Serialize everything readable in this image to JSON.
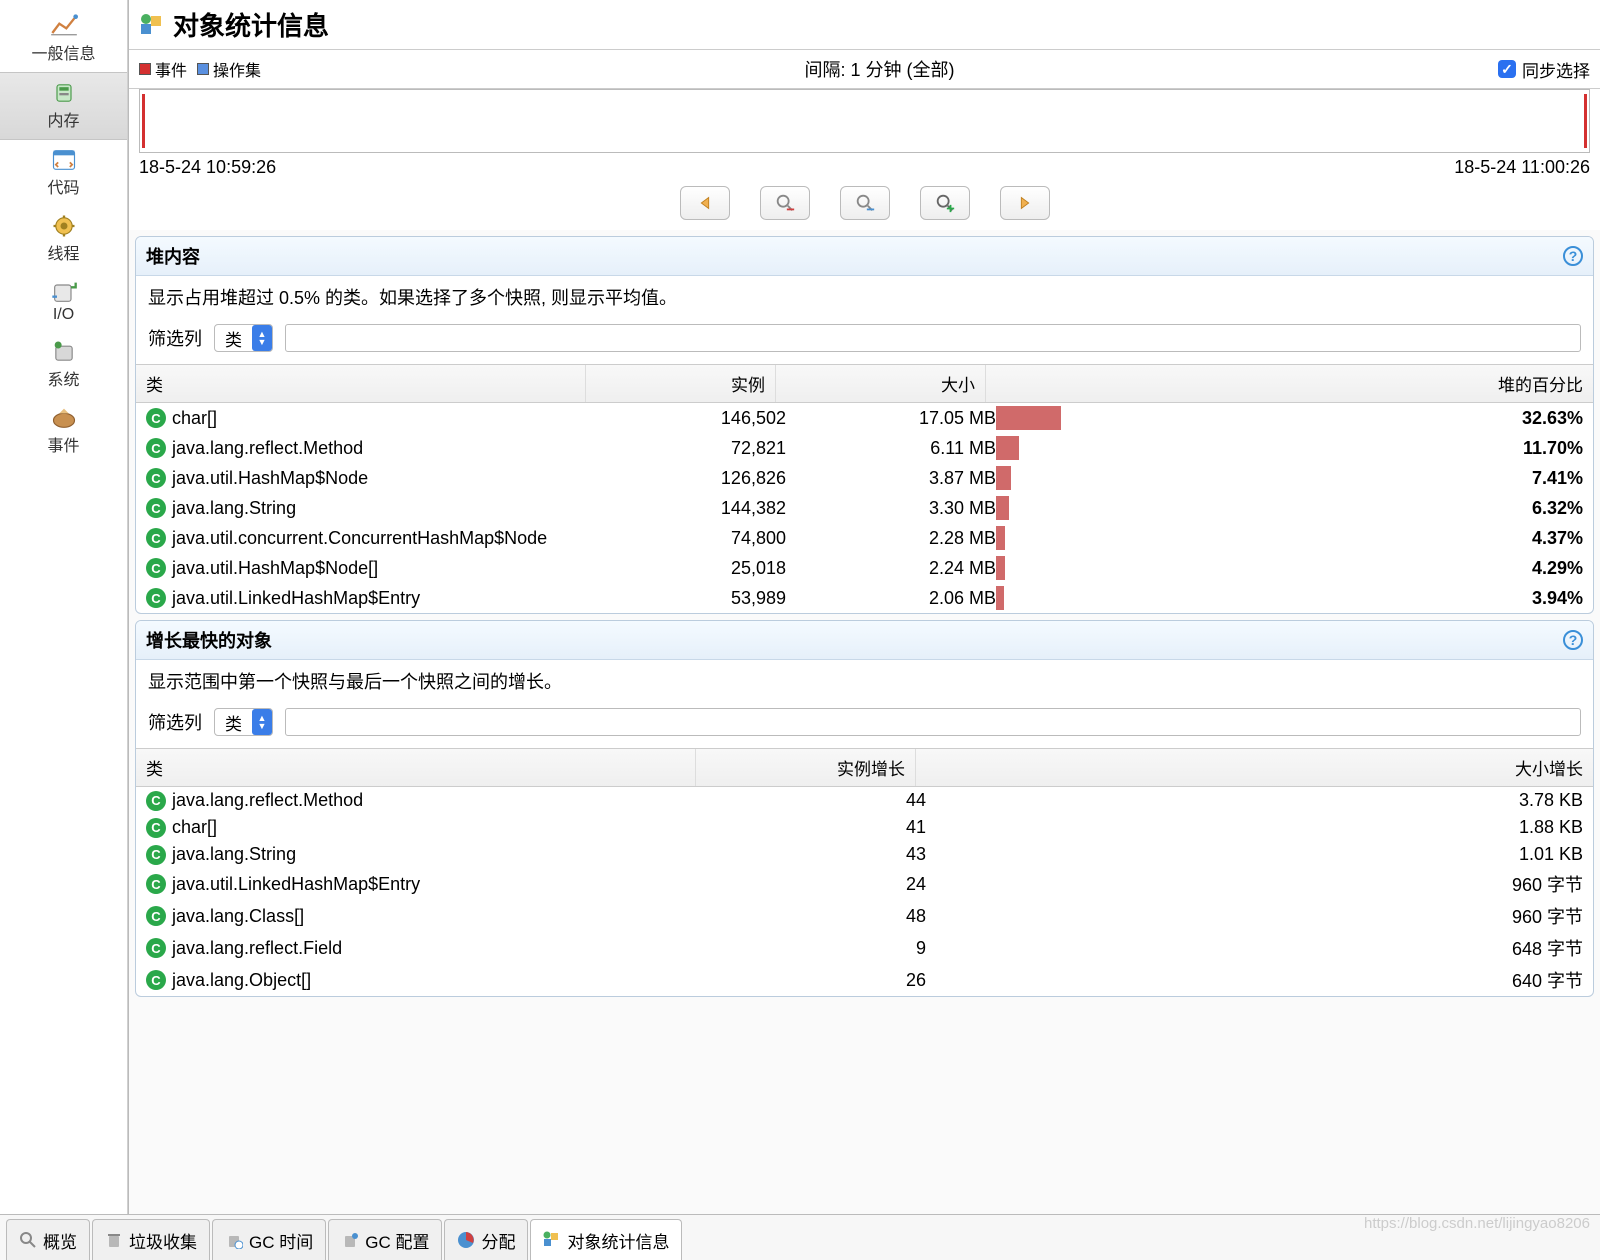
{
  "sidebar": {
    "items": [
      {
        "label": "一般信息",
        "icon": "chart-overview"
      },
      {
        "label": "内存",
        "icon": "memory",
        "active": true
      },
      {
        "label": "代码",
        "icon": "code"
      },
      {
        "label": "线程",
        "icon": "threads"
      },
      {
        "label": "I/O",
        "icon": "io"
      },
      {
        "label": "系统",
        "icon": "system"
      },
      {
        "label": "事件",
        "icon": "events"
      }
    ]
  },
  "page": {
    "title": "对象统计信息"
  },
  "interval": {
    "legend_event": "事件",
    "legend_opset": "操作集",
    "label": "间隔: 1 分钟 (全部)",
    "sync_label": "同步选择",
    "start_time": "18-5-24 10:59:26",
    "end_time": "18-5-24 11:00:26"
  },
  "heap_panel": {
    "title": "堆内容",
    "desc": "显示占用堆超过 0.5% 的类。如果选择了多个快照, 则显示平均值。",
    "filter_label": "筛选列",
    "filter_select": "类",
    "columns": [
      "类",
      "实例",
      "大小",
      "堆的百分比"
    ],
    "rows": [
      {
        "class": "char[]",
        "instances": "146,502",
        "size": "17.05 MB",
        "pct": "32.63%",
        "pct_num": 32.63
      },
      {
        "class": "java.lang.reflect.Method",
        "instances": "72,821",
        "size": "6.11 MB",
        "pct": "11.70%",
        "pct_num": 11.7
      },
      {
        "class": "java.util.HashMap$Node",
        "instances": "126,826",
        "size": "3.87 MB",
        "pct": "7.41%",
        "pct_num": 7.41
      },
      {
        "class": "java.lang.String",
        "instances": "144,382",
        "size": "3.30 MB",
        "pct": "6.32%",
        "pct_num": 6.32
      },
      {
        "class": "java.util.concurrent.ConcurrentHashMap$Node",
        "instances": "74,800",
        "size": "2.28 MB",
        "pct": "4.37%",
        "pct_num": 4.37
      },
      {
        "class": "java.util.HashMap$Node[]",
        "instances": "25,018",
        "size": "2.24 MB",
        "pct": "4.29%",
        "pct_num": 4.29
      },
      {
        "class": "java.util.LinkedHashMap$Entry",
        "instances": "53,989",
        "size": "2.06 MB",
        "pct": "3.94%",
        "pct_num": 3.94
      }
    ]
  },
  "growth_panel": {
    "title": "增长最快的对象",
    "desc": "显示范围中第一个快照与最后一个快照之间的增长。",
    "filter_label": "筛选列",
    "filter_select": "类",
    "columns": [
      "类",
      "实例增长",
      "大小增长"
    ],
    "rows": [
      {
        "class": "java.lang.reflect.Method",
        "inst_growth": "44",
        "size_growth": "3.78 KB"
      },
      {
        "class": "char[]",
        "inst_growth": "41",
        "size_growth": "1.88 KB"
      },
      {
        "class": "java.lang.String",
        "inst_growth": "43",
        "size_growth": "1.01 KB"
      },
      {
        "class": "java.util.LinkedHashMap$Entry",
        "inst_growth": "24",
        "size_growth": "960 字节"
      },
      {
        "class": "java.lang.Class[]",
        "inst_growth": "48",
        "size_growth": "960 字节"
      },
      {
        "class": "java.lang.reflect.Field",
        "inst_growth": "9",
        "size_growth": "648 字节"
      },
      {
        "class": "java.lang.Object[]",
        "inst_growth": "26",
        "size_growth": "640 字节"
      }
    ]
  },
  "tabs": [
    {
      "label": "概览",
      "icon": "overview"
    },
    {
      "label": "垃圾收集",
      "icon": "trash"
    },
    {
      "label": "GC 时间",
      "icon": "trash-clock"
    },
    {
      "label": "GC 配置",
      "icon": "trash-gear"
    },
    {
      "label": "分配",
      "icon": "pie"
    },
    {
      "label": "对象统计信息",
      "icon": "cubes",
      "active": true
    }
  ],
  "watermark": "https://blog.csdn.net/lijingyao8206"
}
